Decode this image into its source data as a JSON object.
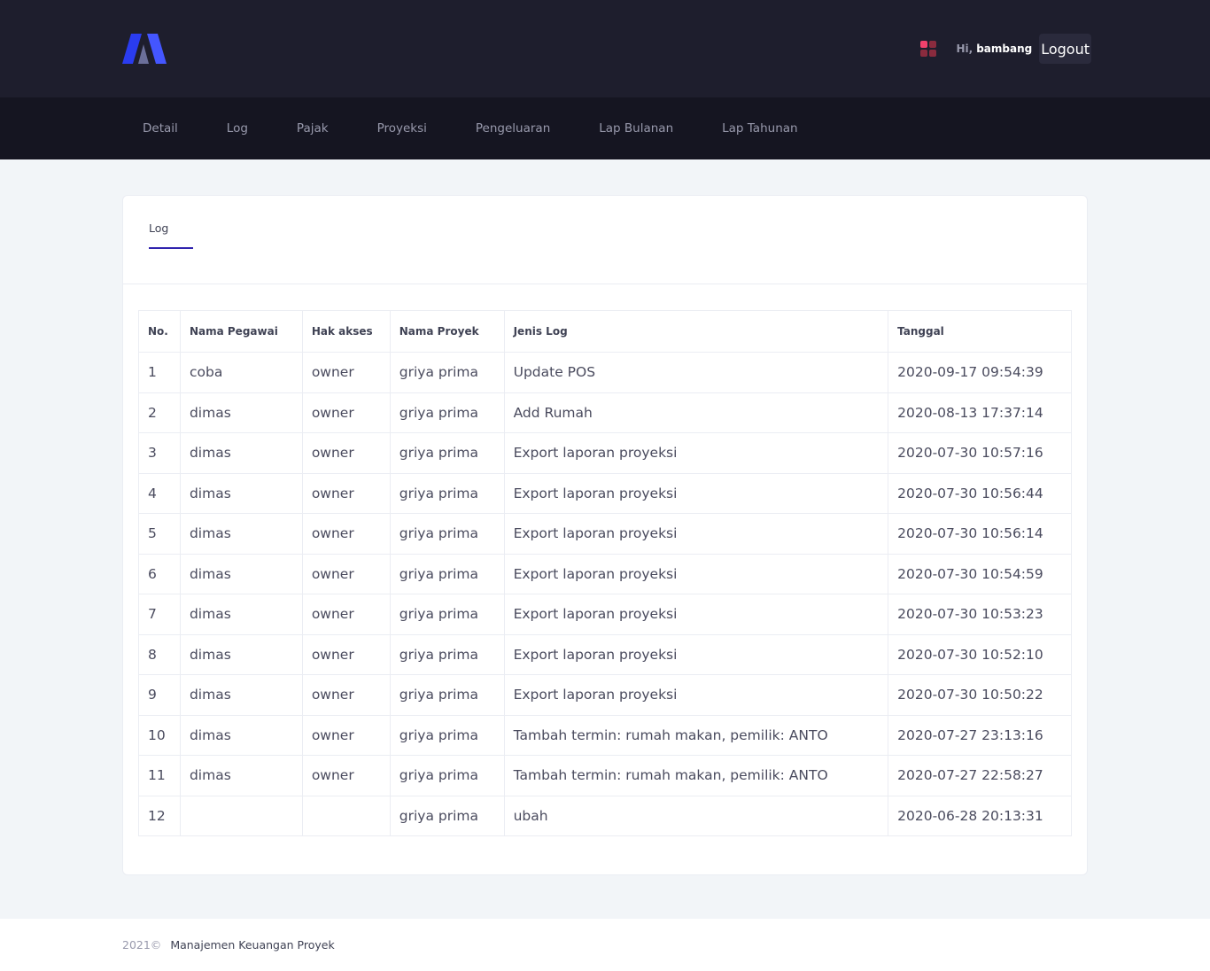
{
  "header": {
    "logo_colors": {
      "left": "#2a3cf0",
      "right": "#4456ff"
    },
    "apps_icon_colors": [
      "#f1416c",
      "#8a2b3e",
      "#8a2b3e",
      "#8a2b3e"
    ],
    "greeting": "Hi,",
    "username": "bambang",
    "logout_label": "Logout"
  },
  "nav": {
    "items": [
      "Detail",
      "Log",
      "Pajak",
      "Proyeksi",
      "Pengeluaran",
      "Lap Bulanan",
      "Lap Tahunan"
    ]
  },
  "card": {
    "tab_label": "Log",
    "accent": "#3023ae"
  },
  "table": {
    "headers": [
      "No.",
      "Nama Pegawai",
      "Hak akses",
      "Nama Proyek",
      "Jenis Log",
      "Tanggal"
    ],
    "rows": [
      [
        "1",
        "coba",
        "owner",
        "griya prima",
        "Update POS",
        "2020-09-17 09:54:39"
      ],
      [
        "2",
        "dimas",
        "owner",
        "griya prima",
        "Add Rumah",
        "2020-08-13 17:37:14"
      ],
      [
        "3",
        "dimas",
        "owner",
        "griya prima",
        "Export laporan proyeksi",
        "2020-07-30 10:57:16"
      ],
      [
        "4",
        "dimas",
        "owner",
        "griya prima",
        "Export laporan proyeksi",
        "2020-07-30 10:56:44"
      ],
      [
        "5",
        "dimas",
        "owner",
        "griya prima",
        "Export laporan proyeksi",
        "2020-07-30 10:56:14"
      ],
      [
        "6",
        "dimas",
        "owner",
        "griya prima",
        "Export laporan proyeksi",
        "2020-07-30 10:54:59"
      ],
      [
        "7",
        "dimas",
        "owner",
        "griya prima",
        "Export laporan proyeksi",
        "2020-07-30 10:53:23"
      ],
      [
        "8",
        "dimas",
        "owner",
        "griya prima",
        "Export laporan proyeksi",
        "2020-07-30 10:52:10"
      ],
      [
        "9",
        "dimas",
        "owner",
        "griya prima",
        "Export laporan proyeksi",
        "2020-07-30 10:50:22"
      ],
      [
        "10",
        "dimas",
        "owner",
        "griya prima",
        "Tambah termin: rumah makan, pemilik: ANTO",
        "2020-07-27 23:13:16"
      ],
      [
        "11",
        "dimas",
        "owner",
        "griya prima",
        "Tambah termin: rumah makan, pemilik: ANTO",
        "2020-07-27 22:58:27"
      ],
      [
        "12",
        "",
        "",
        "griya prima",
        "ubah",
        "2020-06-28 20:13:31"
      ]
    ]
  },
  "footer": {
    "year": "2021©",
    "app_name": "Manajemen Keuangan Proyek"
  }
}
